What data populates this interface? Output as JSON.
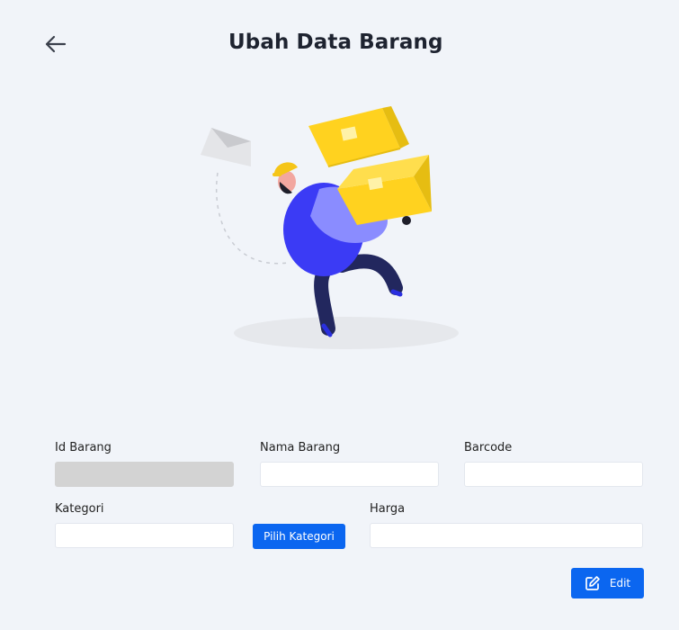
{
  "header": {
    "title": "Ubah Data Barang",
    "back_icon": "arrow-left-icon"
  },
  "illustration": {
    "name": "delivery-person-carrying-boxes",
    "colors": {
      "box": "#ffd21f",
      "shirt": "#3b3bf5",
      "pants": "#22275e",
      "cap": "#f5c518",
      "shadow": "#e6e8ec"
    }
  },
  "form": {
    "id_barang": {
      "label": "Id Barang",
      "value": "",
      "disabled": true
    },
    "nama_barang": {
      "label": "Nama Barang",
      "value": ""
    },
    "barcode": {
      "label": "Barcode",
      "value": ""
    },
    "kategori": {
      "label": "Kategori",
      "value": ""
    },
    "pilih_kategori_label": "Pilih Kategori",
    "harga": {
      "label": "Harga",
      "value": ""
    },
    "edit_label": "Edit",
    "edit_icon": "edit-icon"
  },
  "colors": {
    "background": "#f1f4f9",
    "accent": "#0b66f0",
    "disabled_field": "#d3d3d3"
  }
}
